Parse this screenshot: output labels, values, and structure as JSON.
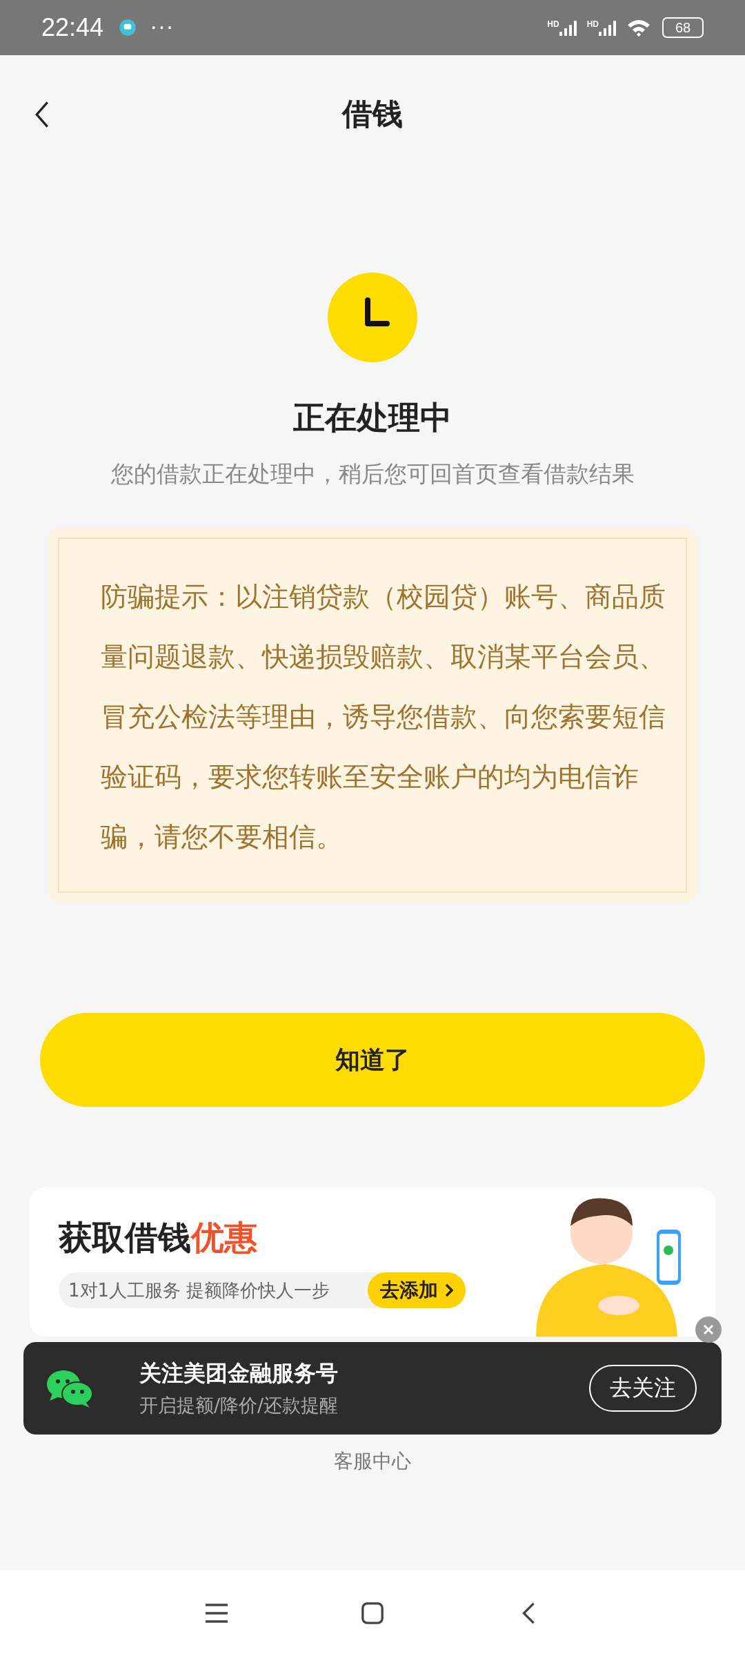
{
  "status_bar": {
    "time": "22:44",
    "more": "···",
    "signal_labels": [
      "HD",
      "HD"
    ],
    "battery": "68"
  },
  "header": {
    "title": "借钱"
  },
  "result": {
    "title": "正在处理中",
    "subtitle": "您的借款正在处理中，稍后您可回首页查看借款结果"
  },
  "notice": {
    "text": "防骗提示：以注销贷款（校园贷）账号、商品质量问题退款、快递损毁赔款、取消某平台会员、冒充公检法等理由，诱导您借款、向您索要短信验证码，要求您转账至安全账户的均为电信诈骗，请您不要相信。"
  },
  "confirm_button": "知道了",
  "banner": {
    "title": "获取借钱",
    "title_highlight": "优惠",
    "tagline": "1对1人工服务 提额降价快人一步",
    "button": "去添加"
  },
  "toast": {
    "title": "关注美团金融服务号",
    "subtitle": "开启提额/降价/还款提醒",
    "button": "去关注"
  },
  "footer_link": "客服中心"
}
